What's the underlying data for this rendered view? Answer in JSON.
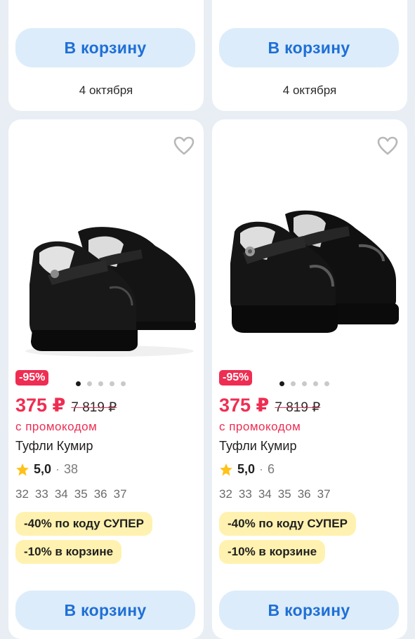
{
  "top_cards": [
    {
      "cart_label": "В корзину",
      "delivery": "4 октября"
    },
    {
      "cart_label": "В корзину",
      "delivery": "4 октября"
    }
  ],
  "products": [
    {
      "discount": "-95%",
      "price": "375 ₽",
      "old_price": "7 819 ₽",
      "promo": "с промокодом",
      "title": "Туфли Кумир",
      "rating": "5,0",
      "reviews": "38",
      "sizes": [
        "32",
        "33",
        "34",
        "35",
        "36",
        "37"
      ],
      "badge1": "-40% по коду  СУПЕР",
      "badge2": "-10% в корзине",
      "cart_label": "В корзину",
      "carousel": {
        "total": 5,
        "active": 1
      }
    },
    {
      "discount": "-95%",
      "price": "375 ₽",
      "old_price": "7 819 ₽",
      "promo": "с промокодом",
      "title": "Туфли Кумир",
      "rating": "5,0",
      "reviews": "6",
      "sizes": [
        "32",
        "33",
        "34",
        "35",
        "36",
        "37"
      ],
      "badge1": "-40% по коду  СУПЕР",
      "badge2": "-10% в корзине",
      "cart_label": "В корзину",
      "carousel": {
        "total": 5,
        "active": 1
      }
    }
  ],
  "colors": {
    "accent_red": "#ef2d52",
    "cart_blue": "#1f6fd6",
    "cart_bg": "#dcecfa",
    "badge_bg": "#fff2b0",
    "star": "#ffc21a"
  },
  "icons": {
    "favorite": "heart-outline-icon",
    "rating": "star-icon"
  }
}
